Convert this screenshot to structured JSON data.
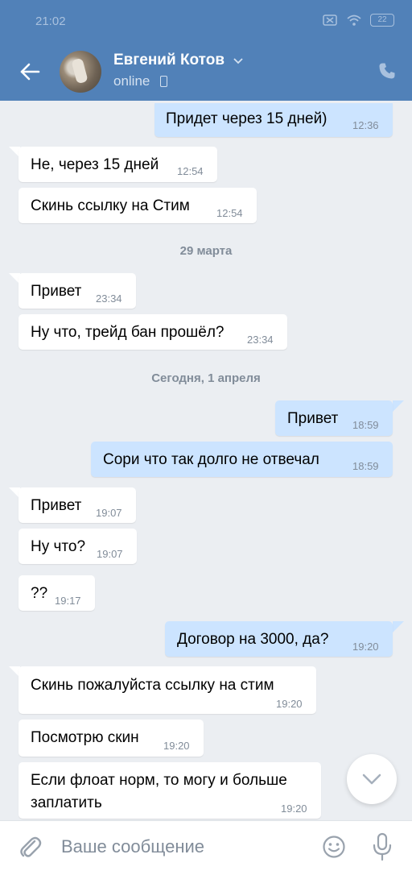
{
  "status_bar": {
    "time": "21:02",
    "battery": "22"
  },
  "header": {
    "contact_name": "Евгений Котов",
    "status": "online"
  },
  "messages": [
    {
      "dir": "out",
      "text": "Придет через 15 дней)",
      "time": "12:36"
    },
    {
      "dir": "in",
      "text": "Не, через 15 дней",
      "time": "12:54"
    },
    {
      "dir": "in",
      "text": "Скинь ссылку на Стим",
      "time": "12:54"
    },
    {
      "dir": "in",
      "text": "Привет",
      "time": "23:34"
    },
    {
      "dir": "in",
      "text": "Ну что, трейд бан прошёл?",
      "time": "23:34"
    },
    {
      "dir": "out",
      "text": "Привет",
      "time": "18:59"
    },
    {
      "dir": "out",
      "text": "Сори что так долго не отвечал",
      "time": "18:59"
    },
    {
      "dir": "in",
      "text": "Привет",
      "time": "19:07"
    },
    {
      "dir": "in",
      "text": "Ну что?",
      "time": "19:07"
    },
    {
      "dir": "in",
      "text": "??",
      "time": "19:17"
    },
    {
      "dir": "out",
      "text": "Договор на 3000, да?",
      "time": "19:20"
    },
    {
      "dir": "in",
      "text": "Скинь пожалуйста ссылку на стим",
      "time": "19:20"
    },
    {
      "dir": "in",
      "text": "Посмотрю скин",
      "time": "19:20"
    },
    {
      "dir": "in",
      "text": "Если флоат норм, то могу и больше",
      "text2": "заплатить",
      "time": "19:20"
    }
  ],
  "date_separators": [
    "29 марта",
    "Сегодня, 1 апреля"
  ],
  "composer": {
    "placeholder": "Ваше сообщение"
  },
  "colors": {
    "header": "#5181b8",
    "background": "#ebeef2",
    "outgoing": "#cce4ff",
    "incoming": "#ffffff"
  }
}
